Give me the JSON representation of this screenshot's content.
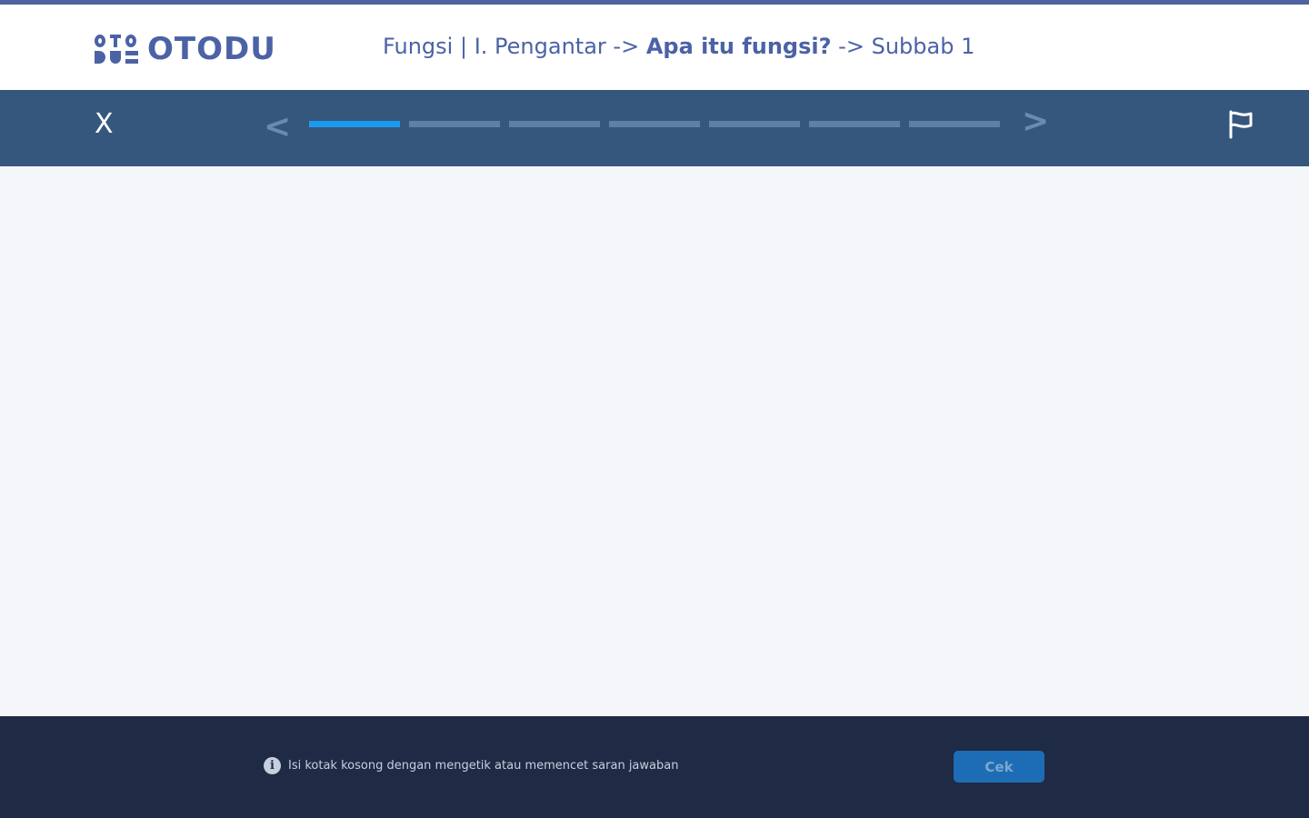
{
  "app": {
    "brand": "OTODU"
  },
  "breadcrumb": {
    "course": "Fungsi",
    "separator": "|",
    "chapter": "I. Pengantar",
    "arrow": "->",
    "topic": "Apa itu fungsi?",
    "subsection": "Subbab 1"
  },
  "navbar": {
    "close_label": "X",
    "prev_label": "<",
    "next_label": ">",
    "progress": {
      "total_steps": 7,
      "current_step": 1
    },
    "flag_icon": "flag-icon"
  },
  "footer": {
    "hint_icon": "info-icon",
    "hint_text": "Isi kotak kosong dengan mengetik atau memencet saran jawaban",
    "check_label": "Cek"
  },
  "colors": {
    "brand": "#4b62a6",
    "navbar": "#36577d",
    "progress_active": "#1a9bef",
    "footer": "#1f2a45",
    "check_button": "#1c6db5"
  }
}
